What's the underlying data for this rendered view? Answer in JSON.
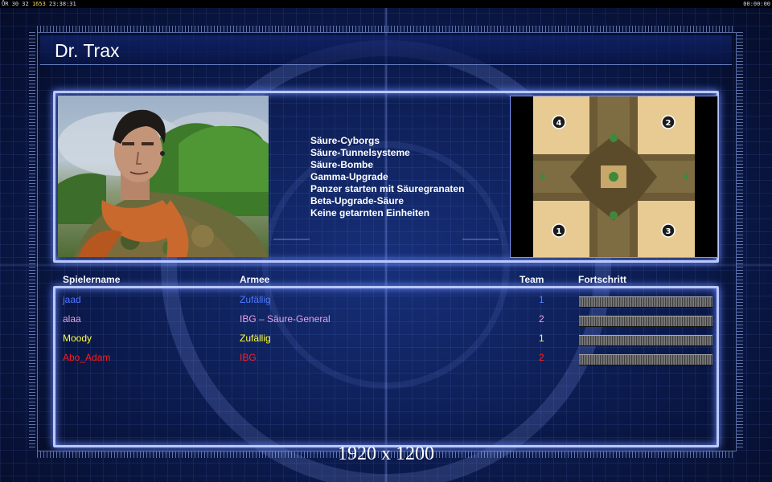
{
  "topbar": {
    "left_prefix": "ŮR 30 32",
    "left_highlight": "1653",
    "left_time": "23:38:31",
    "right_time": "00:00:00"
  },
  "general": {
    "name": "Dr. Trax"
  },
  "perks": [
    "Säure-Cyborgs",
    "Säure-Tunnelsysteme",
    "Säure-Bombe",
    "Gamma-Upgrade",
    "Panzer starten mit Säuregranaten",
    "Beta-Upgrade-Säure",
    "Keine getarnten Einheiten"
  ],
  "map": {
    "start_positions": [
      "4",
      "2",
      "1",
      "3"
    ]
  },
  "table": {
    "headers": {
      "player": "Spielername",
      "army": "Armee",
      "team": "Team",
      "progress": "Fortschritt"
    },
    "rows": [
      {
        "player": "jaad",
        "army": "Zufällig",
        "team": "1",
        "color": "#4f79ff",
        "progress": 1.0
      },
      {
        "player": "alaa",
        "army": "IBG – Säure-General",
        "team": "2",
        "color": "#e6a0e6",
        "progress": 1.0
      },
      {
        "player": "Moody",
        "army": "Zufällig",
        "team": "1",
        "color": "#ffff3a",
        "progress": 1.0
      },
      {
        "player": "Abo_Adam",
        "army": "IBG",
        "team": "2",
        "color": "#ff1e1e",
        "progress": 1.0
      }
    ]
  },
  "footer": {
    "resolution": "1920 x 1200"
  }
}
